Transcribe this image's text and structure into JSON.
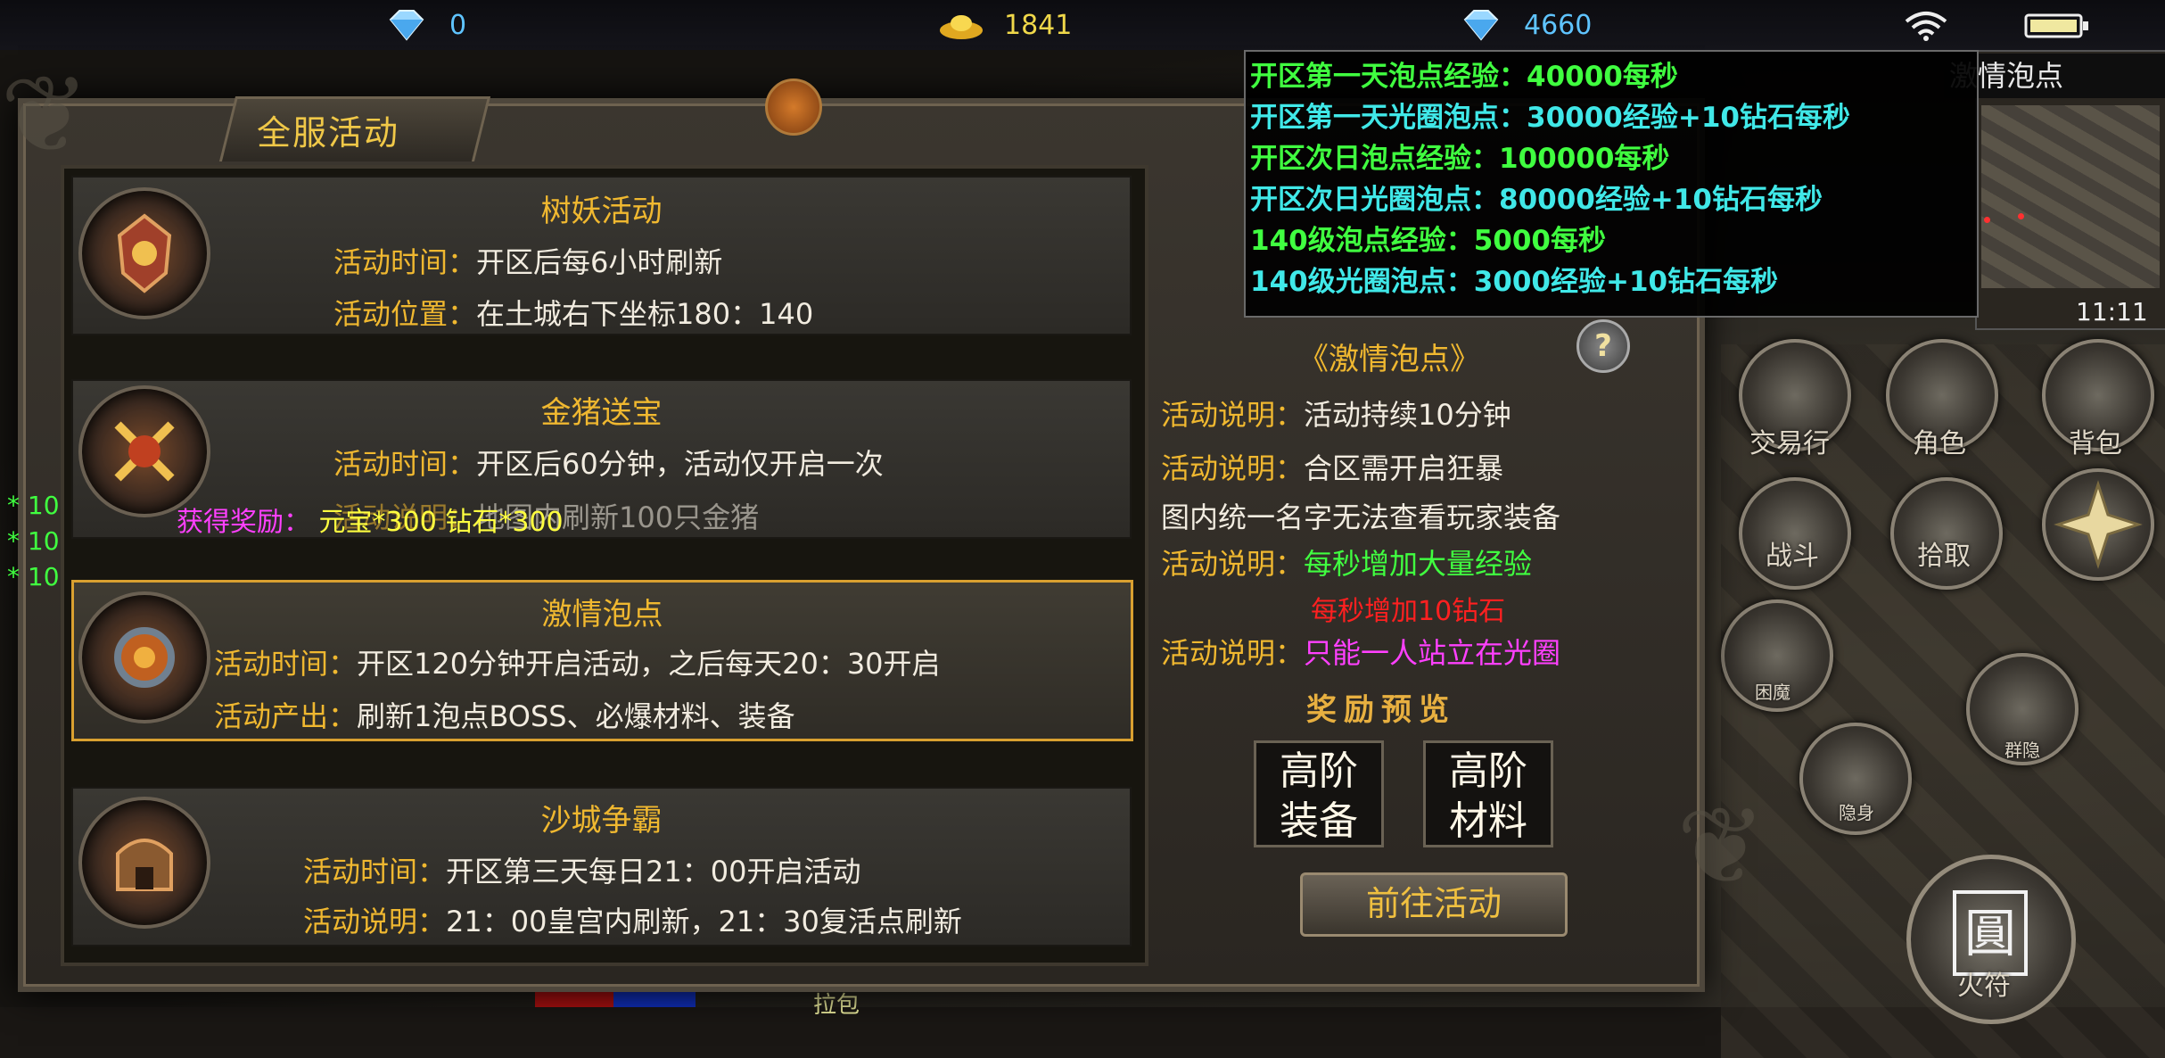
{
  "status_bar": {
    "diamond1_value": "0",
    "gold_value": "1841",
    "diamond2_value": "4660",
    "icons": [
      "diamond-icon",
      "gold-ingot-icon",
      "diamond-icon",
      "wifi-icon",
      "battery-icon"
    ],
    "colors": {
      "diamond_text": "#5fc4ff",
      "gold_text": "#f0d84a"
    }
  },
  "panel": {
    "title": "全服活动",
    "activities": [
      {
        "name": "树妖活动",
        "lines": [
          {
            "label": "活动时间：",
            "value": "开区后每6小时刷新"
          },
          {
            "label": "活动位置：",
            "value": "在土城右下坐标180：140"
          }
        ]
      },
      {
        "name": "金猪送宝",
        "lines": [
          {
            "label": "活动时间：",
            "value": "开区后60分钟，活动仅开启一次"
          },
          {
            "label": "活动说明：",
            "value": "地图内刷新100只金猪"
          }
        ]
      },
      {
        "name": "激情泡点",
        "selected": true,
        "lines": [
          {
            "label": "活动时间：",
            "value": "开区120分钟开启活动，之后每天20：30开启"
          },
          {
            "label": "活动产出：",
            "value": "刷新1泡点BOSS、必爆材料、装备"
          }
        ]
      },
      {
        "name": "沙城争霸",
        "lines": [
          {
            "label": "活动时间：",
            "value": "开区第三天每日21：00开启活动"
          },
          {
            "label": "活动说明：",
            "value": "21：00皇宫内刷新，21：30复活点刷新"
          }
        ]
      }
    ],
    "reward_overlay": {
      "prefix": "获得奖励：",
      "yuanbao": "元宝*300",
      "zuanshi": "钻石*300"
    },
    "side_numbers": [
      "* 10",
      "* 10",
      "* 10"
    ]
  },
  "detail": {
    "help_label": "?",
    "title": "《激情泡点》",
    "lines": [
      {
        "label": "活动说明：",
        "value": "活动持续10分钟",
        "color": "#f2ece0"
      },
      {
        "label": "活动说明：",
        "value": "合区需开启狂暴",
        "color": "#f2ece0"
      },
      {
        "label": "",
        "value": "图内统一名字无法查看玩家装备",
        "color": "#f2ece0"
      },
      {
        "label": "活动说明：",
        "value": "每秒增加大量经验",
        "color": "#40ff40"
      },
      {
        "label": "",
        "value": "每秒增加10钻石",
        "color": "#ff2020"
      },
      {
        "label": "活动说明：",
        "value": "只能一人站立在光圈",
        "color": "#ff40ff"
      }
    ],
    "reward_preview_title": "奖励预览",
    "reward_items": [
      "高阶\n装备",
      "高阶\n材料"
    ],
    "goto_button": "前往活动"
  },
  "tooltip": {
    "lines": [
      {
        "text": "开区第一天泡点经验：40000每秒",
        "color": "#40ff40"
      },
      {
        "text": "开区第一天光圈泡点：30000经验+10钻石每秒",
        "color": "#40e8e8"
      },
      {
        "text": "开区次日泡点经验：100000每秒",
        "color": "#40ff40"
      },
      {
        "text": "开区次日光圈泡点：80000经验+10钻石每秒",
        "color": "#40e8e8"
      },
      {
        "text": "140级泡点经验：5000每秒",
        "color": "#40ff40"
      },
      {
        "text": "140级光圈泡点：3000经验+10钻石每秒",
        "color": "#40e8e8"
      }
    ]
  },
  "minimap": {
    "title": "激情泡点",
    "time": "11:11"
  },
  "skills": [
    {
      "name": "交易行",
      "icon": "trade-icon"
    },
    {
      "name": "角色",
      "icon": "character-icon"
    },
    {
      "name": "背包",
      "icon": "bag-icon"
    },
    {
      "name": "战斗",
      "icon": "swords-icon"
    },
    {
      "name": "拾取",
      "icon": "hand-icon"
    },
    {
      "name": "",
      "icon": "shuriken-icon"
    },
    {
      "name": "困魔",
      "icon": "trap-icon"
    },
    {
      "name": "群隐",
      "icon": "group-stealth-icon"
    },
    {
      "name": "隐身",
      "icon": "stealth-icon"
    },
    {
      "name": "火符",
      "icon": "fire-talisman-icon"
    }
  ],
  "big_skill_glyph": "圓",
  "bottom_strip_text": "拉包"
}
